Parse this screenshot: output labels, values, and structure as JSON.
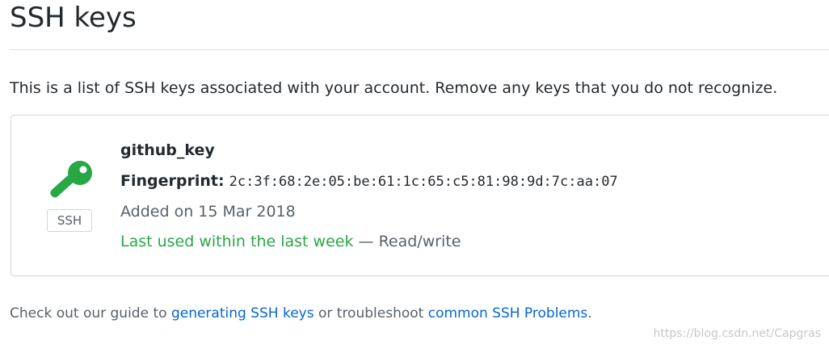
{
  "page": {
    "title": "SSH keys",
    "description": "This is a list of SSH keys associated with your account. Remove any keys that you do not recognize."
  },
  "key": {
    "icon": "key-icon",
    "icon_color": "#28a745",
    "type_label": "SSH",
    "title": "github_key",
    "fingerprint_label": "Fingerprint:",
    "fingerprint": "2c:3f:68:2e:05:be:61:1c:65:c5:81:98:9d:7c:aa:07",
    "added": "Added on 15 Mar 2018",
    "last_used": "Last used within the last week",
    "access": " — Read/write"
  },
  "footer": {
    "prefix": "Check out our guide to ",
    "link_generating": "generating SSH keys",
    "middle": " or troubleshoot ",
    "link_problems": "common SSH Problems",
    "suffix": "."
  },
  "watermark": {
    "text": "https://blog.csdn.net/Capgras"
  },
  "colors": {
    "link": "#0366d6",
    "success": "#28a745",
    "muted": "#586069"
  }
}
